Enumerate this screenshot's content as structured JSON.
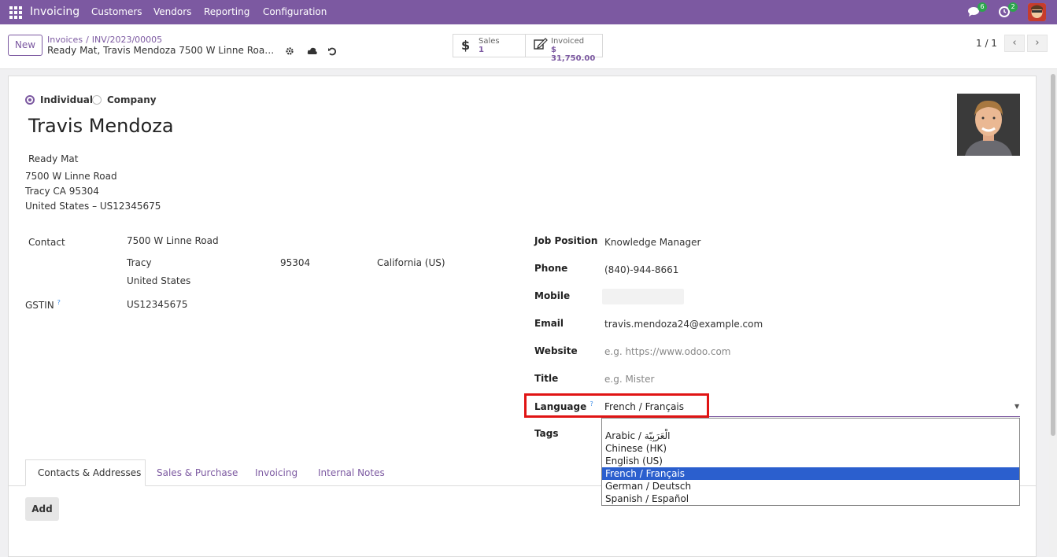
{
  "navbar": {
    "app_name": "Invoicing",
    "menus": [
      "Customers",
      "Vendors",
      "Reporting",
      "Configuration"
    ],
    "messages_count": "6",
    "activities_count": "2",
    "color": "#7c59a1"
  },
  "control": {
    "new_label": "New",
    "breadcrumb": [
      "Invoices",
      "INV/2023/00005"
    ],
    "record_title": "Ready Mat, Travis Mendoza 7500 W Linne Road Tr...",
    "stats": [
      {
        "icon": "dollar-icon",
        "label": "Sales",
        "value": "1"
      },
      {
        "icon": "pencil-square-icon",
        "label": "Invoiced",
        "value": "$ 31,750.00"
      }
    ],
    "pager": "1 / 1"
  },
  "form": {
    "company_type": {
      "individual": "Individual",
      "company": "Company",
      "selected": "Individual"
    },
    "name": "Travis Mendoza",
    "address_block": [
      "Ready Mat",
      "7500 W Linne Road",
      "Tracy CA 95304",
      "United States – US12345675"
    ],
    "contact_label": "Contact",
    "street": "7500 W Linne Road",
    "city": "Tracy",
    "zip": "95304",
    "state": "California (US)",
    "country": "United States",
    "gstin_label": "GSTIN",
    "gstin_value": "US12345675",
    "help_mark": "?",
    "job_position_label": "Job Position",
    "job_position": "Knowledge Manager",
    "phone_label": "Phone",
    "phone": "(840)-944-8661",
    "mobile_label": "Mobile",
    "email_label": "Email",
    "email": "travis.mendoza24@example.com",
    "website_label": "Website",
    "website_placeholder": "e.g. https://www.odoo.com",
    "title_label": "Title",
    "title_placeholder": "e.g. Mister",
    "language_label": "Language",
    "language_value": "French / Français",
    "tags_label": "Tags"
  },
  "language_dropdown": {
    "options": [
      "Arabic / الْعَرَبِيّة",
      "Chinese (HK)",
      "English (US)",
      "French / Français",
      "German / Deutsch",
      "Spanish / Español"
    ],
    "selected_index": 3,
    "highlight_color": "#e01414"
  },
  "tabs": [
    "Contacts & Addresses",
    "Sales & Purchase",
    "Invoicing",
    "Internal Notes"
  ],
  "add_label": "Add"
}
